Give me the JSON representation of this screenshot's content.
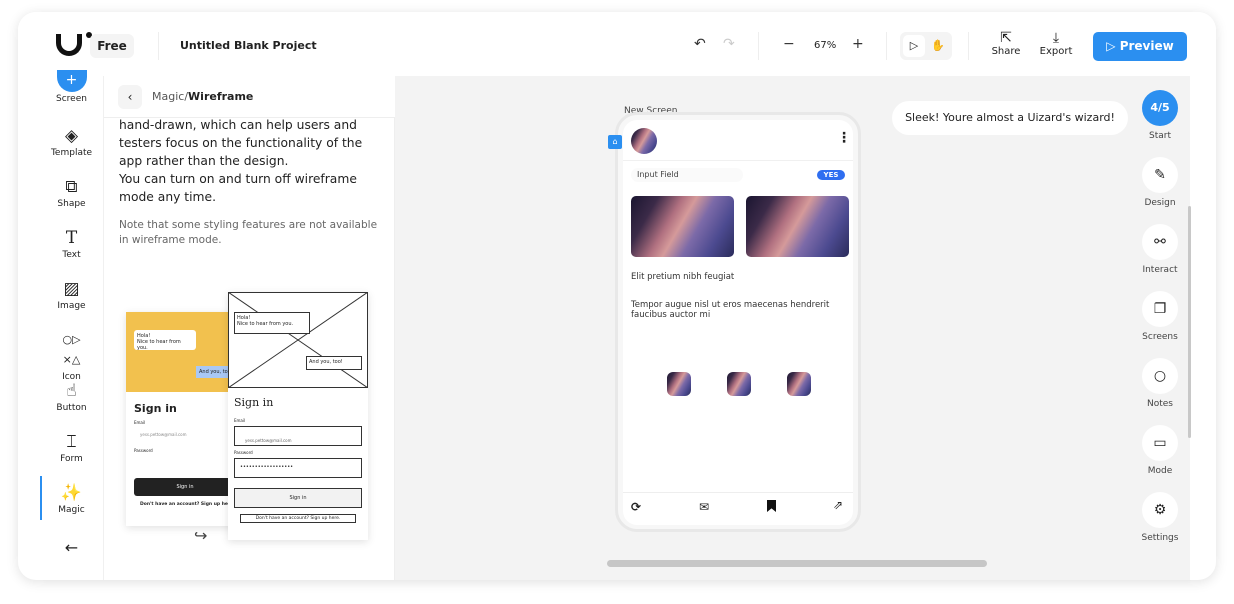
{
  "header": {
    "plan": "Free",
    "project_title": "Untitled Blank Project",
    "zoom": "67%",
    "share": "Share",
    "export": "Export",
    "preview": "Preview"
  },
  "left_toolbar": {
    "items": [
      {
        "label": "Screen",
        "icon": "plus-icon"
      },
      {
        "label": "Template",
        "icon": "layers-icon"
      },
      {
        "label": "Shape",
        "icon": "shape-icon"
      },
      {
        "label": "Text",
        "icon": "text-icon"
      },
      {
        "label": "Image",
        "icon": "image-icon"
      },
      {
        "label": "Icon",
        "icon": "icon-icon"
      },
      {
        "label": "Button",
        "icon": "button-icon"
      },
      {
        "label": "Form",
        "icon": "form-icon"
      },
      {
        "label": "Magic",
        "icon": "magic-wand-icon"
      }
    ]
  },
  "panel": {
    "breadcrumb_parent": "Magic",
    "breadcrumb_sep": "/",
    "breadcrumb_current": "Wireframe",
    "body_lines": [
      "hand-drawn, which can help users and",
      "testers focus on the functionality of the",
      "app rather than the design.",
      "You can turn on and turn off wireframe",
      "mode any time."
    ],
    "note": "Note that some styling features are not available in wireframe mode.",
    "illustration": {
      "bubble1a": "Hola!",
      "bubble1b": "Nice to hear from you.",
      "bubble2": "And you, too!",
      "sign_in": "Sign in",
      "email_label": "Email",
      "email_value": "yess.pettow@mail.com",
      "password_label": "Password",
      "password_value": "••••••••••••••••••",
      "sign_in_button": "Sign in",
      "signup": "Don't have an account? Sign up here."
    }
  },
  "canvas": {
    "screen_name": "New Screen",
    "tip": "Sleek! Youre almost a Uizard's wizard!",
    "phone": {
      "input_placeholder": "Input Field",
      "badge": "YES",
      "heading": "Elit pretium nibh feugiat",
      "paragraph": "Tempor augue nisl ut eros maecenas hendrerit faucibus auctor mi"
    }
  },
  "right_toolbar": {
    "progress": "4/5",
    "start": "Start",
    "items": [
      "Design",
      "Interact",
      "Screens",
      "Notes",
      "Mode",
      "Settings"
    ]
  },
  "colors": {
    "accent": "#2b8ff0",
    "canvas_bg": "#f3f3f3",
    "badge": "#2f6ef0",
    "illustration_yellow": "#f2c14e"
  }
}
